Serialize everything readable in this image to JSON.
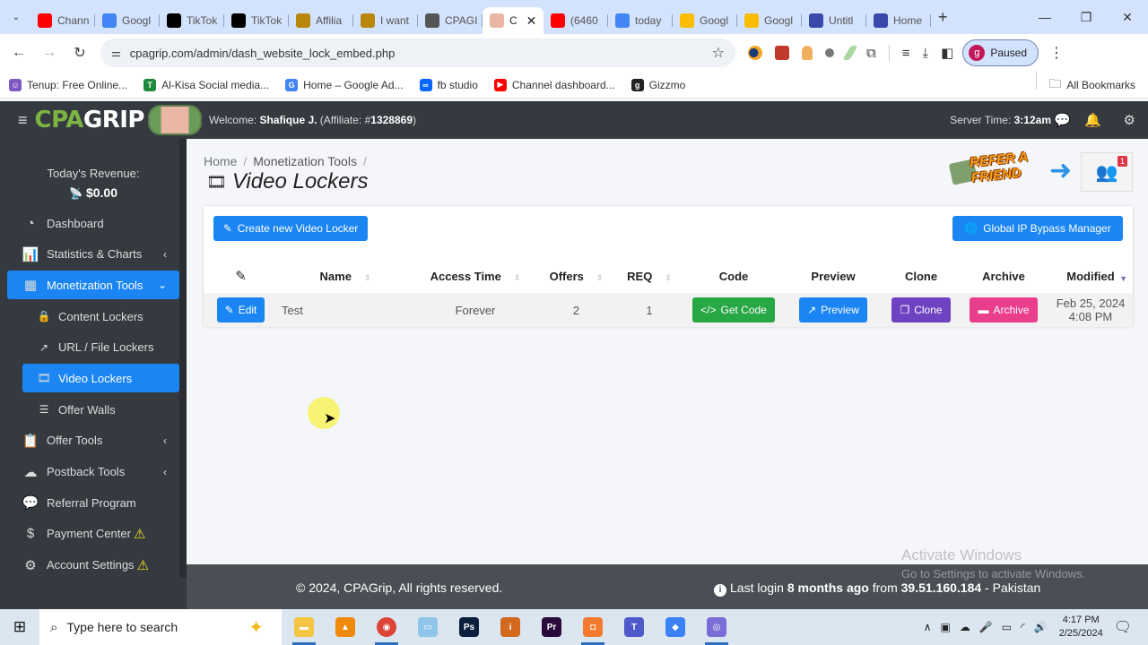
{
  "browser": {
    "tabs": [
      {
        "label": "Chann",
        "icon": "youtube-icon",
        "color": "#ff0000",
        "active": false
      },
      {
        "label": "Googl",
        "icon": "google-icon",
        "color": "#4285f4",
        "active": false
      },
      {
        "label": "TikTok",
        "icon": "tiktok-icon",
        "color": "#000000",
        "active": false
      },
      {
        "label": "TikTok",
        "icon": "tiktok-icon",
        "color": "#000000",
        "active": false
      },
      {
        "label": "Affilia",
        "icon": "warrior-icon",
        "color": "#b8860b",
        "active": false
      },
      {
        "label": "I want",
        "icon": "warrior-icon",
        "color": "#b8860b",
        "active": false
      },
      {
        "label": "CPAGI",
        "icon": "globe-icon",
        "color": "#555555",
        "active": false
      },
      {
        "label": "C",
        "icon": "cpagrip-icon",
        "color": "#e9b7a3",
        "active": true
      },
      {
        "label": "(6460",
        "icon": "youtube-icon",
        "color": "#ff0000",
        "active": false
      },
      {
        "label": "today",
        "icon": "google-icon",
        "color": "#4285f4",
        "active": false
      },
      {
        "label": "Googl",
        "icon": "google-ads-icon",
        "color": "#fbbc04",
        "active": false
      },
      {
        "label": "Googl",
        "icon": "google-ads-icon",
        "color": "#fbbc04",
        "active": false
      },
      {
        "label": "Untitl",
        "icon": "sites-icon",
        "color": "#3949ab",
        "active": false
      },
      {
        "label": "Home",
        "icon": "sites-icon",
        "color": "#3949ab",
        "active": false
      }
    ],
    "new_tab": "+",
    "url": "cpagrip.com/admin/dash_website_lock_embed.php",
    "profile_initial": "g",
    "profile_status": "Paused",
    "bookmarks": [
      {
        "label": "Tenup: Free Online...",
        "color": "#7e57c2",
        "glyph": "☺"
      },
      {
        "label": "Al-Kisa Social media...",
        "color": "#1b8a3a",
        "glyph": "T"
      },
      {
        "label": "Home – Google Ad...",
        "color": "#4285f4",
        "glyph": "G"
      },
      {
        "label": "fb studio",
        "color": "#0866ff",
        "glyph": "∞"
      },
      {
        "label": "Channel dashboard...",
        "color": "#ff0000",
        "glyph": "▶"
      },
      {
        "label": "Gizzmo",
        "color": "#222222",
        "glyph": "g"
      }
    ],
    "all_bookmarks": "All Bookmarks"
  },
  "header": {
    "logo_cpa": "CPA",
    "logo_grip": "GRIP",
    "welcome_prefix": "Welcome: ",
    "user_name": "Shafique J.",
    "affiliate_prefix": " (Affiliate: #",
    "affiliate_id": "1328869",
    "affiliate_suffix": ")",
    "server_time_label": "Server Time: ",
    "server_time": "3:12am"
  },
  "sidebar": {
    "revenue_label": "Today's Revenue:",
    "revenue_amount": "$0.00",
    "items": [
      {
        "label": "Dashboard",
        "icon": "dashboard-icon",
        "glyph": "◔"
      },
      {
        "label": "Statistics & Charts",
        "icon": "chart-icon",
        "glyph": "📊",
        "chevron": "‹"
      },
      {
        "label": "Monetization Tools",
        "icon": "grid-icon",
        "glyph": "▦",
        "chevron": "⌄",
        "active": true
      },
      {
        "label": "Content Lockers",
        "icon": "lock-icon",
        "glyph": "🔒",
        "sub": true
      },
      {
        "label": "URL / File Lockers",
        "icon": "link-icon",
        "glyph": "↗",
        "sub": true
      },
      {
        "label": "Video Lockers",
        "icon": "film-icon",
        "glyph": "🎞",
        "sub": true,
        "active": true
      },
      {
        "label": "Offer Walls",
        "icon": "table-icon",
        "glyph": "☰",
        "sub": true
      },
      {
        "label": "Offer Tools",
        "icon": "clipboard-icon",
        "glyph": "📋",
        "chevron": "‹"
      },
      {
        "label": "Postback Tools",
        "icon": "cloud-icon",
        "glyph": "☁",
        "chevron": "‹"
      },
      {
        "label": "Referral Program",
        "icon": "comments-dollar-icon",
        "glyph": "💬"
      },
      {
        "label": "Payment Center",
        "icon": "money-check-icon",
        "glyph": "$",
        "warn": "⚠"
      },
      {
        "label": "Account Settings",
        "icon": "gear-icon",
        "glyph": "⚙",
        "warn": "⚠"
      }
    ]
  },
  "main": {
    "breadcrumb": [
      "Home",
      "Monetization Tools"
    ],
    "title": "Video Lockers",
    "create_button": "Create new Video Locker",
    "ip_bypass_button": "Global IP Bypass Manager",
    "referral_text_1": "REFER A",
    "referral_text_2": "FRIEND",
    "referral_badge": "1",
    "table": {
      "columns": [
        "",
        "Name",
        "Access Time",
        "Offers",
        "REQ",
        "Code",
        "Preview",
        "Clone",
        "Archive",
        "Modified"
      ],
      "rows": [
        {
          "edit_label": "Edit",
          "name": "Test",
          "access_time": "Forever",
          "offers": "2",
          "req": "1",
          "code_label": "Get Code",
          "preview_label": "Preview",
          "clone_label": "Clone",
          "archive_label": "Archive",
          "modified": "Feb 25, 2024 4:08 PM"
        }
      ]
    }
  },
  "footer": {
    "copyright": "© 2024, CPAGrip, All rights reserved.",
    "last_login_prefix": "Last login ",
    "last_login_when": "8 months ago",
    "last_login_from": " from ",
    "last_login_ip": "39.51.160.184",
    "last_login_country": " - Pakistan"
  },
  "watermark": {
    "title": "Activate Windows",
    "subtitle": "Go to Settings to activate Windows."
  },
  "taskbar": {
    "search_placeholder": "Type here to search",
    "apps": [
      {
        "name": "file-explorer",
        "color": "#f4c542",
        "glyph": "▬",
        "running": true
      },
      {
        "name": "vlc",
        "color": "#f08a0c",
        "glyph": "▲",
        "running": false
      },
      {
        "name": "chrome",
        "color": "#db4437",
        "glyph": "◉",
        "running": true
      },
      {
        "name": "notepad",
        "color": "#8ec5e8",
        "glyph": "▭",
        "running": false
      },
      {
        "name": "photoshop",
        "color": "#0a1f3c",
        "glyph": "Ps",
        "running": false
      },
      {
        "name": "inpage",
        "color": "#d2691e",
        "glyph": "i",
        "running": false
      },
      {
        "name": "premiere",
        "color": "#2a0a3c",
        "glyph": "Pr",
        "running": false
      },
      {
        "name": "screen-recorder",
        "color": "#f47a30",
        "glyph": "◘",
        "running": true
      },
      {
        "name": "teams",
        "color": "#5059c9",
        "glyph": "T",
        "running": false
      },
      {
        "name": "copilot",
        "color": "#3b82f6",
        "glyph": "◆",
        "running": false
      },
      {
        "name": "bittorrent",
        "color": "#7a6dd6",
        "glyph": "◎",
        "running": true
      }
    ],
    "time": "4:17 PM",
    "date": "2/25/2024"
  }
}
